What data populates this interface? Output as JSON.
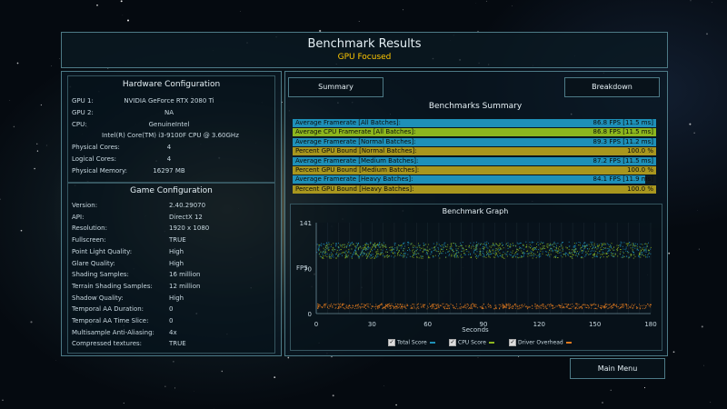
{
  "header": {
    "title": "Benchmark Results",
    "subtitle": "GPU Focused"
  },
  "hardware": {
    "title": "Hardware Configuration",
    "rows": [
      {
        "label": "GPU 1:",
        "value": "NVIDIA GeForce RTX 2080 Ti"
      },
      {
        "label": "GPU 2:",
        "value": "NA"
      },
      {
        "label": "CPU:",
        "value": "GenuineIntel"
      },
      {
        "label": "",
        "value": "Intel(R) Core(TM) i3-9100F CPU @ 3.60GHz"
      },
      {
        "label": "Physical Cores:",
        "value": "4"
      },
      {
        "label": "Logical Cores:",
        "value": "4"
      },
      {
        "label": "Physical Memory:",
        "value": "16297 MB"
      }
    ]
  },
  "game": {
    "title": "Game Configuration",
    "rows": [
      {
        "label": "Version:",
        "value": "2.40.29070"
      },
      {
        "label": "API:",
        "value": "DirectX 12"
      },
      {
        "label": "Resolution:",
        "value": "1920 x 1080"
      },
      {
        "label": "Fullscreen:",
        "value": "TRUE"
      },
      {
        "label": "Point Light Quality:",
        "value": "High"
      },
      {
        "label": "Glare Quality:",
        "value": "High"
      },
      {
        "label": "Shading Samples:",
        "value": "16 million"
      },
      {
        "label": "Terrain Shading Samples:",
        "value": "12 million"
      },
      {
        "label": "Shadow Quality:",
        "value": "High"
      },
      {
        "label": "Temporal AA Duration:",
        "value": "0"
      },
      {
        "label": "Temporal AA Time Slice:",
        "value": "0"
      },
      {
        "label": "Multisample Anti-Aliasing:",
        "value": "4x"
      },
      {
        "label": "Compressed textures:",
        "value": "TRUE"
      }
    ]
  },
  "tabs": {
    "summary": "Summary",
    "breakdown": "Breakdown"
  },
  "summary": {
    "title": "Benchmarks Summary",
    "rows": [
      {
        "label": "Average Framerate [All Batches]:",
        "value": "86.8 FPS [11.5 ms]",
        "color": "#1e90b8",
        "fill": 1.0
      },
      {
        "label": "Average CPU Framerate [All Batches]:",
        "value": "86.8 FPS [11.5 ms]",
        "color": "#8cb61e",
        "fill": 1.0
      },
      {
        "label": "Average Framerate [Normal Batches]:",
        "value": "89.3 FPS [11.2 ms]",
        "color": "#1e90b8",
        "fill": 1.0
      },
      {
        "label": "Percent GPU Bound [Normal Batches]:",
        "value": "100.0 %",
        "color": "#a8961e",
        "fill": 1.0
      },
      {
        "label": "Average Framerate [Medium Batches]:",
        "value": "87.2 FPS [11.5 ms]",
        "color": "#1e90b8",
        "fill": 1.0
      },
      {
        "label": "Percent GPU Bound [Medium Batches]:",
        "value": "100.0 %",
        "color": "#a8961e",
        "fill": 1.0
      },
      {
        "label": "Average Framerate [Heavy Batches]:",
        "value": "84.1 FPS [11.9 ms]",
        "color": "#1e90b8",
        "fill": 0.97
      },
      {
        "label": "Percent GPU Bound [Heavy Batches]:",
        "value": "100.0 %",
        "color": "#a8961e",
        "fill": 1.0
      }
    ]
  },
  "graph": {
    "title": "Benchmark Graph",
    "ylabel": "FPS",
    "xlabel": "Seconds",
    "legend": [
      {
        "label": "Total Score",
        "color": "#1e90b8"
      },
      {
        "label": "CPU Score",
        "color": "#8cb61e"
      },
      {
        "label": "Driver Overhead",
        "color": "#e07a1e"
      }
    ]
  },
  "chart_data": {
    "type": "scatter",
    "title": "Benchmark Graph",
    "xlabel": "Seconds",
    "ylabel": "FPS",
    "xlim": [
      0,
      180
    ],
    "ylim": [
      0,
      141
    ],
    "xticks": [
      "0",
      "30",
      "60",
      "90",
      "120",
      "150",
      "180"
    ],
    "yticks": [
      "0",
      "70",
      "141"
    ],
    "series": [
      {
        "name": "Total Score",
        "y_approx": 100
      },
      {
        "name": "CPU Score",
        "y_approx": 98
      },
      {
        "name": "Driver Overhead",
        "y_approx": 12
      }
    ],
    "grid": true,
    "legend_position": "bottom"
  },
  "footer": {
    "main_menu": "Main Menu"
  }
}
